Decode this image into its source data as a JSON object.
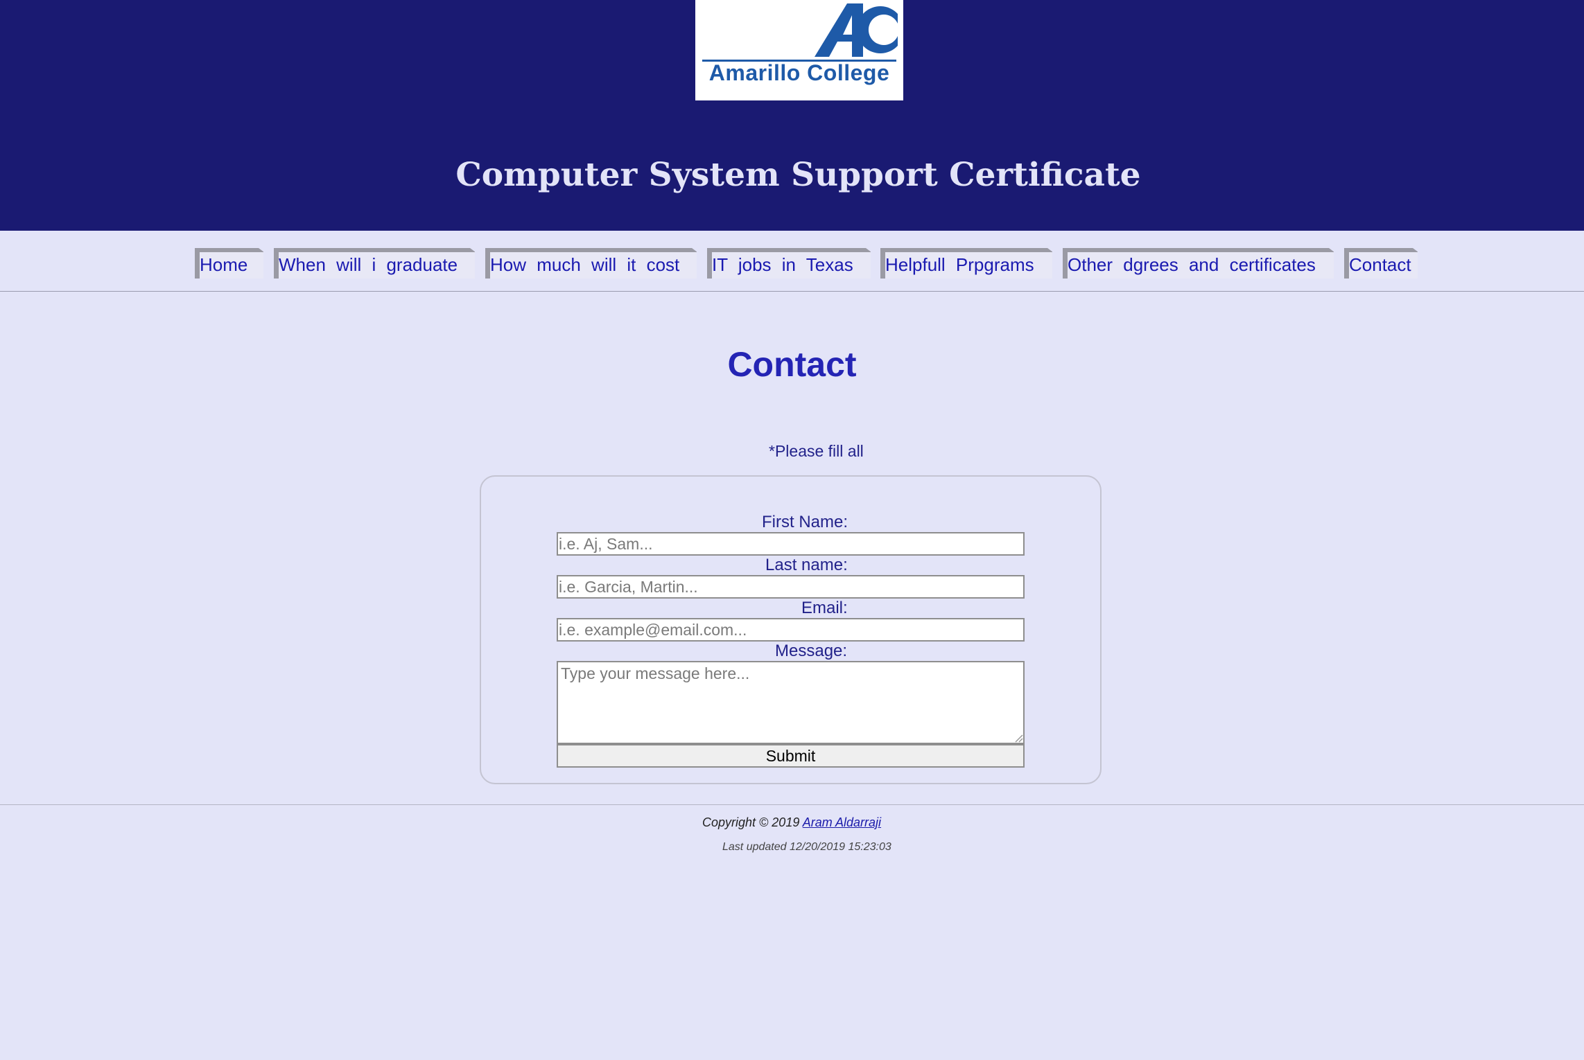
{
  "header": {
    "logo_text": "Amarillo College",
    "site_title": "Computer System Support Certificate",
    "colors": {
      "header_bg": "#1a1a72",
      "logo_blue": "#1e5aa8"
    }
  },
  "nav": {
    "items": [
      {
        "label": "Home"
      },
      {
        "label": "When will i graduate"
      },
      {
        "label": "How much will it cost"
      },
      {
        "label": "IT jobs in Texas"
      },
      {
        "label": "Helpfull Prpgrams"
      },
      {
        "label": "Other dgrees and certificates"
      },
      {
        "label": "Contact"
      }
    ]
  },
  "main": {
    "heading": "Contact",
    "note": "*Please fill all",
    "form": {
      "first_name_label": "First Name:",
      "first_name_placeholder": "i.e. Aj, Sam...",
      "last_name_label": "Last name:",
      "last_name_placeholder": "i.e. Garcia, Martin...",
      "email_label": "Email:",
      "email_placeholder": "i.e. example@email.com...",
      "message_label": "Message:",
      "message_placeholder": "Type your message here...",
      "submit_label": "Submit"
    }
  },
  "footer": {
    "copyright_prefix": "Copyright © 2019",
    "author": "Aram Aldarraji",
    "last_updated": "Last updated 12/20/2019 15:23:03"
  }
}
